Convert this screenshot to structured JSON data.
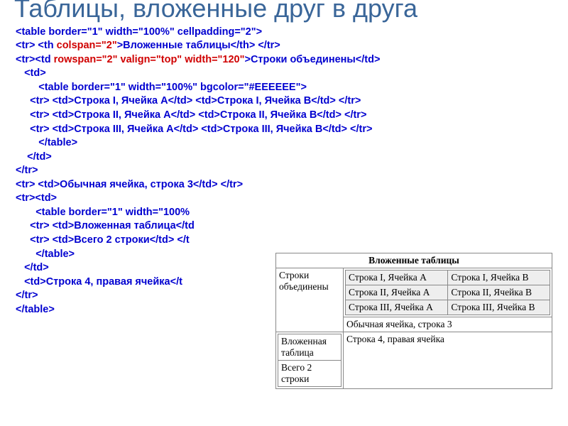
{
  "title": "Таблицы, вложенные друг в друга",
  "code": {
    "l1": "<table border=\"1\" width=\"100%\" cellpadding=\"2\">",
    "l2a": "<tr> <th ",
    "l2red": "colspan=\"2\"",
    "l2b": ">Вложенные таблицы</th> </tr>",
    "l3a": "<tr><td ",
    "l3red": "rowspan=\"2\" valign=\"top\" width=\"120\"",
    "l3b": ">Строки объединены</td>",
    "l4": "   <td>",
    "l5": "        <table border=\"1\" width=\"100%\" bgcolor=\"#EEEEEE\">",
    "l6": "     <tr> <td>Строка I, Ячейка A</td> <td>Строка I, Ячейка B</td> </tr>",
    "l7": "     <tr> <td>Строка II, Ячейка A</td> <td>Строка II, Ячейка B</td> </tr>",
    "l8": "     <tr> <td>Строка III, Ячейка A</td> <td>Строка III, Ячейка B</td> </tr>",
    "l9": "        </table>",
    "l10": "    </td>",
    "l11": "</tr>",
    "l12": "<tr> <td>Обычная ячейка, строка 3</td> </tr>",
    "l13": "<tr><td>",
    "l14": "       <table border=\"1\" width=\"100%",
    "l15": "     <tr> <td>Вложенная таблица</td",
    "l16": "     <tr> <td>Всего 2 строки</td> </t",
    "l17": "       </table>",
    "l18": "   </td>",
    "l19": "   <td>Строка 4, правая ячейка</t",
    "l20": "</tr>",
    "l21": "</table>"
  },
  "demo": {
    "header": "Вложенные таблицы",
    "merged": "Строки объединены",
    "inner": [
      [
        "Строка I, Ячейка A",
        "Строка I, Ячейка B"
      ],
      [
        "Строка II, Ячейка A",
        "Строка II, Ячейка B"
      ],
      [
        "Строка III, Ячейка A",
        "Строка III, Ячейка B"
      ]
    ],
    "plain": "Обычная ячейка, строка 3",
    "nested2": [
      "Вложенная таблица",
      "Всего 2 строки"
    ],
    "row4right": "Строка 4, правая ячейка"
  }
}
